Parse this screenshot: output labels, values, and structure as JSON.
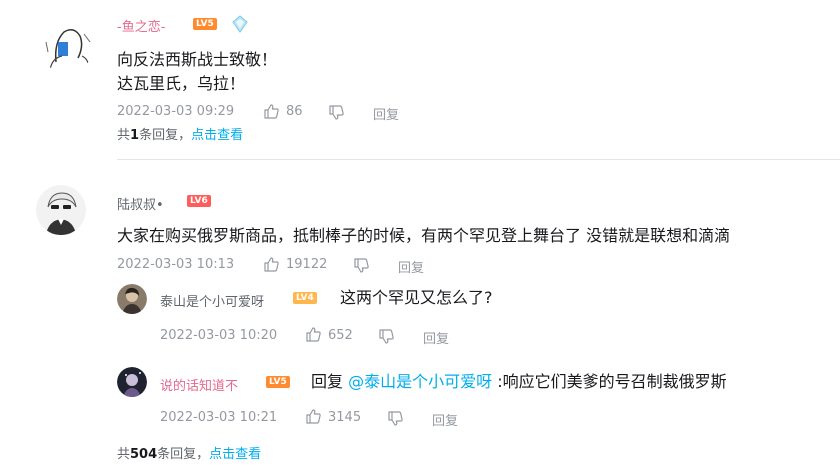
{
  "comments": [
    {
      "user": "-鱼之恋-",
      "name_color": "#e36a8d",
      "level": "LV5",
      "level_color": "#ff8b2e",
      "lines": [
        "向反法西斯战士致敬！",
        "达瓦里氏，乌拉！"
      ],
      "time": "2022-03-03 09:29",
      "likes": "86",
      "reply_label": "回复",
      "summary_prefix": "共",
      "summary_count": "1",
      "summary_suffix": "条回复，",
      "summary_link": "点击查看"
    },
    {
      "user": "陆叔叔•",
      "name_color": "#61666d",
      "level": "LV6",
      "level_color": "#ff5c5c",
      "lines": [
        "大家在购买俄罗斯商品，抵制棒子的时候，有两个罕见登上舞台了 没错就是联想和滴滴"
      ],
      "time": "2022-03-03 10:13",
      "likes": "19122",
      "reply_label": "回复",
      "replies": [
        {
          "user": "泰山是个小可爱呀",
          "level": "LV4",
          "level_color": "#ffb74d",
          "text": "这两个罕见又怎么了?",
          "time": "2022-03-03 10:20",
          "likes": "652",
          "reply_label": "回复"
        },
        {
          "user": "说的话知道不",
          "name_color": "#e36a8d",
          "level": "LV5",
          "level_color": "#ff8b2e",
          "prefix": "回复 ",
          "mention": "@泰山是个小可爱呀",
          "text": " :响应它们美爹的号召制裁俄罗斯",
          "time": "2022-03-03 10:21",
          "likes": "3145",
          "reply_label": "回复"
        }
      ],
      "summary_prefix": "共",
      "summary_count": "504",
      "summary_suffix": "条回复，",
      "summary_link": "点击查看"
    }
  ]
}
